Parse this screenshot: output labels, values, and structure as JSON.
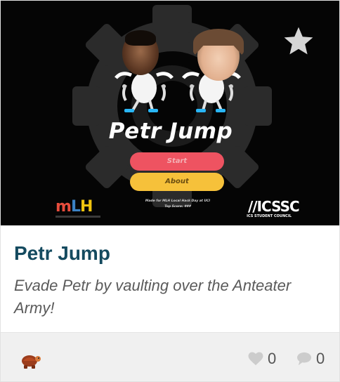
{
  "thumbnail": {
    "game_title": "Petr Jump",
    "start_label": "Start",
    "about_label": "About",
    "footnote_line1": "Made for MLH Local Hack Day at UCI",
    "footnote_line2": "Top Score: ###",
    "mlh_logo": {
      "m": "m",
      "l": "L",
      "h": "H"
    },
    "icssc_logo": "//ICSSC",
    "icssc_sub": "ICS STUDENT COUNCIL"
  },
  "card": {
    "title": "Petr Jump",
    "description": "Evade Petr by vaulting over the Anteater Army!"
  },
  "footer": {
    "likes": "0",
    "comments": "0"
  },
  "icons": {
    "favorite": "star-icon",
    "like": "heart-icon",
    "comment": "comment-bubble-icon",
    "author": "turtle-avatar-icon"
  },
  "colors": {
    "title": "#144a5f",
    "description": "#5a5a5a",
    "start_button": "#ee5361",
    "about_button": "#f6c13a",
    "footer_bg": "#f0f0f0"
  }
}
